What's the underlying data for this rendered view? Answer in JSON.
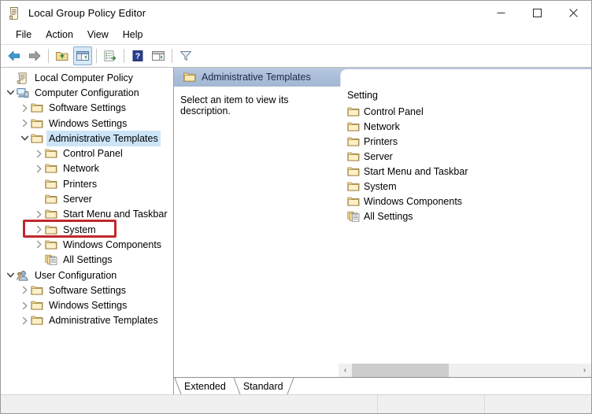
{
  "window": {
    "title": "Local Group Policy Editor",
    "icon": "policy-document-icon",
    "minimize_label": "—",
    "maximize_label": "□",
    "close_label": "✕"
  },
  "menubar": {
    "items": [
      {
        "label": "File"
      },
      {
        "label": "Action"
      },
      {
        "label": "View"
      },
      {
        "label": "Help"
      }
    ]
  },
  "toolbar": {
    "buttons": [
      {
        "name": "back-icon",
        "tip": "Back"
      },
      {
        "name": "forward-icon",
        "tip": "Forward"
      },
      {
        "name": "up-folder-icon",
        "tip": "Up One Level"
      },
      {
        "name": "show-hide-console-tree-icon",
        "tip": "Show/Hide Console Tree",
        "active": true
      },
      {
        "name": "export-list-icon",
        "tip": "Export List"
      },
      {
        "name": "help-icon",
        "tip": "Help"
      },
      {
        "name": "show-hide-action-pane-icon",
        "tip": "Show/Hide Action Pane"
      },
      {
        "name": "filter-icon",
        "tip": "Filter"
      }
    ]
  },
  "tree": {
    "items": [
      {
        "label": "Local Computer Policy",
        "depth": 0,
        "twisty": "none",
        "icon": "policy-document-icon",
        "selected": false,
        "highlight": false
      },
      {
        "label": "Computer Configuration",
        "depth": 0,
        "twisty": "open",
        "icon": "computer-icon",
        "selected": false,
        "highlight": false
      },
      {
        "label": "Software Settings",
        "depth": 1,
        "twisty": "closed",
        "icon": "folder-icon",
        "selected": false,
        "highlight": false
      },
      {
        "label": "Windows Settings",
        "depth": 1,
        "twisty": "closed",
        "icon": "folder-icon",
        "selected": false,
        "highlight": false
      },
      {
        "label": "Administrative Templates",
        "depth": 1,
        "twisty": "open",
        "icon": "folder-icon",
        "selected": true,
        "highlight": false
      },
      {
        "label": "Control Panel",
        "depth": 2,
        "twisty": "closed",
        "icon": "folder-icon",
        "selected": false,
        "highlight": false
      },
      {
        "label": "Network",
        "depth": 2,
        "twisty": "closed",
        "icon": "folder-icon",
        "selected": false,
        "highlight": false
      },
      {
        "label": "Printers",
        "depth": 2,
        "twisty": "none",
        "icon": "folder-icon",
        "selected": false,
        "highlight": false
      },
      {
        "label": "Server",
        "depth": 2,
        "twisty": "none",
        "icon": "folder-icon",
        "selected": false,
        "highlight": false
      },
      {
        "label": "Start Menu and Taskbar",
        "depth": 2,
        "twisty": "closed",
        "icon": "folder-icon",
        "selected": false,
        "highlight": false
      },
      {
        "label": "System",
        "depth": 2,
        "twisty": "closed",
        "icon": "folder-icon",
        "selected": false,
        "highlight": true
      },
      {
        "label": "Windows Components",
        "depth": 2,
        "twisty": "closed",
        "icon": "folder-icon",
        "selected": false,
        "highlight": false
      },
      {
        "label": "All Settings",
        "depth": 2,
        "twisty": "none",
        "icon": "all-settings-icon",
        "selected": false,
        "highlight": false
      },
      {
        "label": "User Configuration",
        "depth": 0,
        "twisty": "open",
        "icon": "user-icon",
        "selected": false,
        "highlight": false
      },
      {
        "label": "Software Settings",
        "depth": 1,
        "twisty": "closed",
        "icon": "folder-icon",
        "selected": false,
        "highlight": false
      },
      {
        "label": "Windows Settings",
        "depth": 1,
        "twisty": "closed",
        "icon": "folder-icon",
        "selected": false,
        "highlight": false
      },
      {
        "label": "Administrative Templates",
        "depth": 1,
        "twisty": "closed",
        "icon": "folder-icon",
        "selected": false,
        "highlight": false
      }
    ],
    "highlight_color": "#c0282d",
    "selection_color": "#cce4f7"
  },
  "right_pane": {
    "header": {
      "title": "Administrative Templates",
      "icon": "folder-icon"
    },
    "description": "Select an item to view its description.",
    "list": {
      "column_header": "Setting",
      "rows": [
        {
          "label": "Control Panel",
          "icon": "folder-icon"
        },
        {
          "label": "Network",
          "icon": "folder-icon"
        },
        {
          "label": "Printers",
          "icon": "folder-icon"
        },
        {
          "label": "Server",
          "icon": "folder-icon"
        },
        {
          "label": "Start Menu and Taskbar",
          "icon": "folder-icon"
        },
        {
          "label": "System",
          "icon": "folder-icon"
        },
        {
          "label": "Windows Components",
          "icon": "folder-icon"
        },
        {
          "label": "All Settings",
          "icon": "all-settings-icon"
        }
      ]
    },
    "scrollbar": {
      "left_arrow": "‹",
      "right_arrow": "›",
      "thumb_position_percent": 0,
      "thumb_width_percent": 43
    },
    "tabs": [
      {
        "label": "Extended",
        "selected": false
      },
      {
        "label": "Standard",
        "selected": true
      }
    ]
  }
}
